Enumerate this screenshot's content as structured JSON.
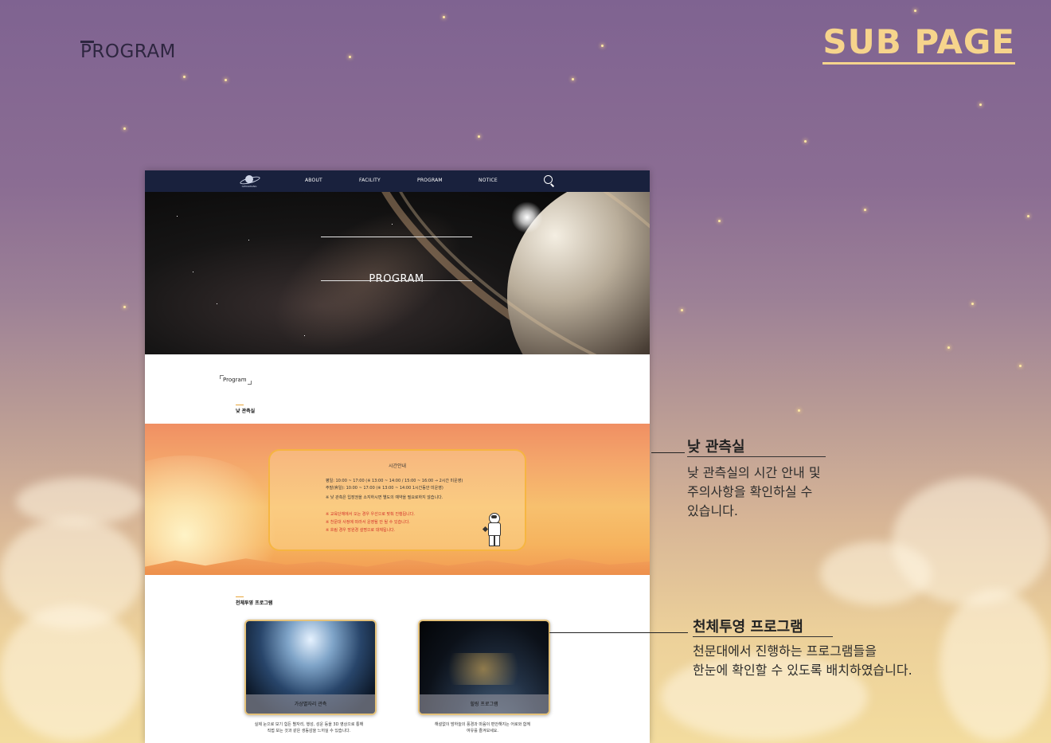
{
  "header": {
    "section_label": "PROGRAM",
    "page_type": "SUB PAGE"
  },
  "site": {
    "logo_text": "GWAGWANG",
    "nav": [
      "ABOUT",
      "FACILITY",
      "PROGRAM",
      "NOTICE"
    ],
    "hero_title": "PROGRAM",
    "breadcrumb": "Program",
    "day_section_label": "낮 관측실",
    "schedule": {
      "title": "시간안내",
      "lines": [
        "평일: 10:00 ~ 17:00 (※ 13:00 ~ 14:00 / 15:00 ~ 16:00 → 2시간 미운영)",
        "주말(휴일): 10:00 ~ 17:00 (※ 13:00 ~ 14:00 1시간동안 미운영)",
        "※ 낮 관측은 입장권을 소지하시면 별도의 예약을 필요로하지 않습니다."
      ],
      "notes": [
        "※ 교육단체에서 오는 경우 우선으로 맞춰 진행됩니다.",
        "※ 천문대 사정에 따라서 운영될 안 될 수 있습니다.",
        "※ 흐림 경우 망원경 설명으로 대체됩니다."
      ]
    },
    "program_section_label": "천체투영 프로그램",
    "programs": [
      {
        "title": "가상별자리 관측",
        "desc_line1": "실제 눈으로 보기 힘든 별자리, 행성, 성운 등을 3D 영상으로 통해",
        "desc_line2": "직접 보는 것과 같은 생동감을 느끼실 수 있습니다."
      },
      {
        "title": "힐링 프로그램",
        "desc_line1": "해설없이 밤하늘의 풍경과 마음이 편안해지는 어로와 함께",
        "desc_line2": "여유를 즐겨보세요."
      }
    ]
  },
  "annotations": [
    {
      "title": "낮 관측실",
      "lines": [
        "낮 관측실의 시간 안내 및",
        "주의사항을 확인하실 수",
        "있습니다."
      ]
    },
    {
      "title": "천체투영 프로그램",
      "lines": [
        "천문대에서 진행하는 프로그램들을",
        "한눈에 확인할 수 있도록 배치하였습니다."
      ]
    }
  ],
  "colors": {
    "accent_gold": "#f6d48c",
    "nav_bg": "#19213d",
    "notice_red": "#d2312a"
  }
}
